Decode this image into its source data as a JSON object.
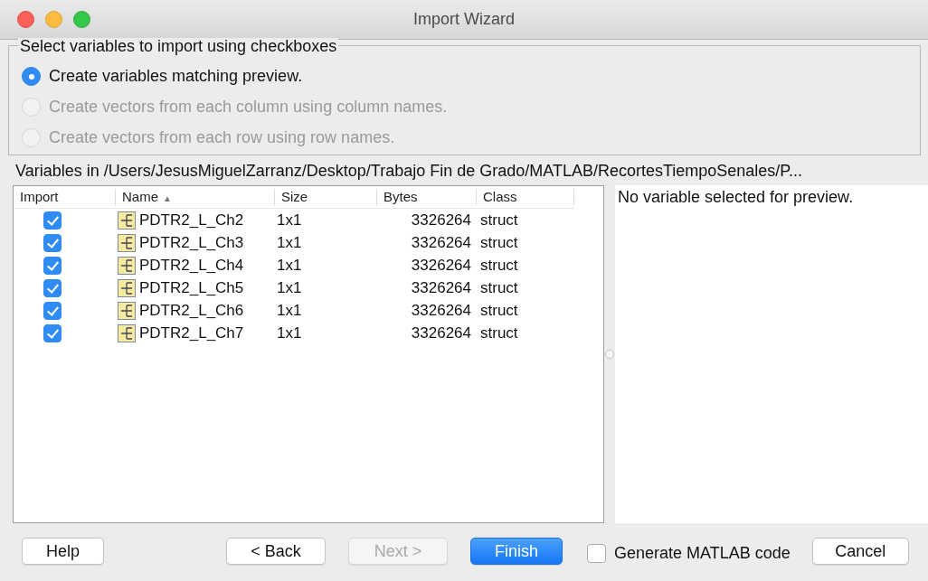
{
  "window": {
    "title": "Import Wizard"
  },
  "options": {
    "legend": "Select variables to import using checkboxes",
    "radios": [
      {
        "label": "Create variables matching preview.",
        "selected": true,
        "disabled": false
      },
      {
        "label": "Create vectors from each column using column names.",
        "selected": false,
        "disabled": true
      },
      {
        "label": "Create vectors from each row using row names.",
        "selected": false,
        "disabled": true
      }
    ]
  },
  "path_label": "Variables in /Users/JesusMiguelZarranz/Desktop/Trabajo Fin de Grado/MATLAB/RecortesTiempoSenales/P...",
  "table": {
    "columns": [
      {
        "label": "Import"
      },
      {
        "label": "Name",
        "sort_indicator": "▲"
      },
      {
        "label": "Size"
      },
      {
        "label": "Bytes"
      },
      {
        "label": "Class"
      }
    ],
    "rows": [
      {
        "checked": true,
        "name": "PDTR2_L_Ch2",
        "size": "1x1",
        "bytes": "3326264",
        "class": "struct"
      },
      {
        "checked": true,
        "name": "PDTR2_L_Ch3",
        "size": "1x1",
        "bytes": "3326264",
        "class": "struct"
      },
      {
        "checked": true,
        "name": "PDTR2_L_Ch4",
        "size": "1x1",
        "bytes": "3326264",
        "class": "struct"
      },
      {
        "checked": true,
        "name": "PDTR2_L_Ch5",
        "size": "1x1",
        "bytes": "3326264",
        "class": "struct"
      },
      {
        "checked": true,
        "name": "PDTR2_L_Ch6",
        "size": "1x1",
        "bytes": "3326264",
        "class": "struct"
      },
      {
        "checked": true,
        "name": "PDTR2_L_Ch7",
        "size": "1x1",
        "bytes": "3326264",
        "class": "struct"
      }
    ]
  },
  "preview": {
    "message": "No variable selected for preview."
  },
  "footer": {
    "buttons": [
      {
        "label": "Help",
        "kind": "normal",
        "disabled": false
      },
      {
        "label": "< Back",
        "kind": "normal",
        "disabled": false
      },
      {
        "label": "Next >",
        "kind": "normal",
        "disabled": true
      },
      {
        "label": "Finish",
        "kind": "default",
        "disabled": false
      }
    ],
    "checkbox": {
      "label": "Generate MATLAB code",
      "checked": false
    },
    "cancel": {
      "label": "Cancel"
    }
  }
}
